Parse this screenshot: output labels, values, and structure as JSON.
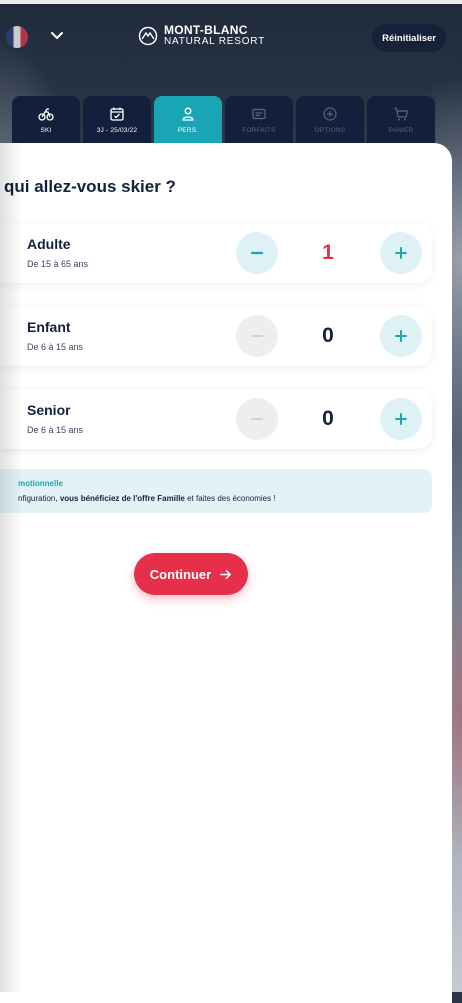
{
  "header": {
    "brand_line1": "MONT-BLANC",
    "brand_line2": "NATURAL RESORT",
    "reset_label": "Réinitialiser"
  },
  "tabs": [
    {
      "label": "SKI",
      "icon": "bike-icon",
      "state": "normal"
    },
    {
      "label": "3J - 25/03/22",
      "icon": "calendar-icon",
      "state": "normal"
    },
    {
      "label": "PERS.",
      "icon": "person-icon",
      "state": "active"
    },
    {
      "label": "FORFAITS",
      "icon": "ticket-icon",
      "state": "disabled"
    },
    {
      "label": "OPTIONS",
      "icon": "plus-circle-icon",
      "state": "disabled"
    },
    {
      "label": "PANIER",
      "icon": "cart-icon",
      "state": "disabled"
    }
  ],
  "main": {
    "title": "qui allez-vous skier ?",
    "rows": [
      {
        "name": "Adulte",
        "sub": "De 15 à 65 ans",
        "count": "1",
        "minus_enabled": true
      },
      {
        "name": "Enfant",
        "sub": "De 6 à 15 ans",
        "count": "0",
        "minus_enabled": false
      },
      {
        "name": "Senior",
        "sub": "De 6 à 15 ans",
        "count": "0",
        "minus_enabled": false
      }
    ],
    "promo": {
      "title": "motionnelle",
      "text_before": "nfiguration, ",
      "text_bold": "vous bénéficiez de l'offre Famille",
      "text_after": " et faites des économies !"
    },
    "continue_label": "Continuer",
    "continue_icon": "arrow-right-icon"
  },
  "colors": {
    "primary": "#14213d",
    "accent": "#1aa5b5",
    "cta": "#e6304b",
    "light_accent": "#def1f4"
  }
}
